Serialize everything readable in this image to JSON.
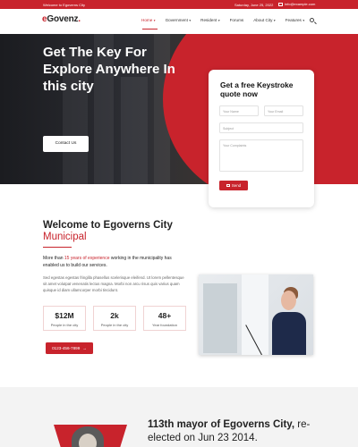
{
  "topbar": {
    "welcome": "Welcome to Egoverns City",
    "date": "Saturday, June 25, 2022",
    "email": "info@example.com"
  },
  "header": {
    "logo_e": "e",
    "logo_rest": "Govenz",
    "logo_dot": ".",
    "nav": [
      {
        "label": "Home",
        "active": true,
        "has_caret": true
      },
      {
        "label": "Government",
        "has_caret": true
      },
      {
        "label": "Resident",
        "has_caret": true
      },
      {
        "label": "Forums",
        "has_caret": false
      },
      {
        "label": "About City",
        "has_caret": true
      },
      {
        "label": "Features",
        "has_caret": true
      }
    ],
    "caret": "▾",
    "search_icon": "search-icon"
  },
  "hero": {
    "title": "Get The Key For Explore Anywhere In this city",
    "button": "Contact Us"
  },
  "quote": {
    "title": "Get a free Keystroke quote now",
    "name_placeholder": "Your Name",
    "email_placeholder": "Your Email",
    "subject_placeholder": "Subject",
    "complaints_placeholder": "Your Complaints",
    "send": "Send"
  },
  "welcome": {
    "title": "Welcome to Egoverns City",
    "subtitle": "Municipal",
    "lead_pre": "More than ",
    "lead_highlight": "15 years of experience",
    "lead_post": " working in the municipality has enabled us to build our services.",
    "body": "Sed egestas egestas fringilla phasellus scelerisque eleifend. Ut lorem pellentesque sit amet volutpat venenatis lectus magna. Morbi non arcu risus quis varius quam quisque id diam ullamcorper morbi tincidunt.",
    "stats": [
      {
        "value": "$12M",
        "label": "People in the city"
      },
      {
        "value": "2k",
        "label": "People in the city"
      },
      {
        "value": "48+",
        "label": "Year foundation"
      }
    ],
    "phone": "0123-456-7899"
  },
  "mayor": {
    "bold": "113th mayor of Egoverns City,",
    "rest": " re-elected on Jun 23 2014."
  },
  "colors": {
    "accent": "#c8232c",
    "dark": "#222222"
  }
}
